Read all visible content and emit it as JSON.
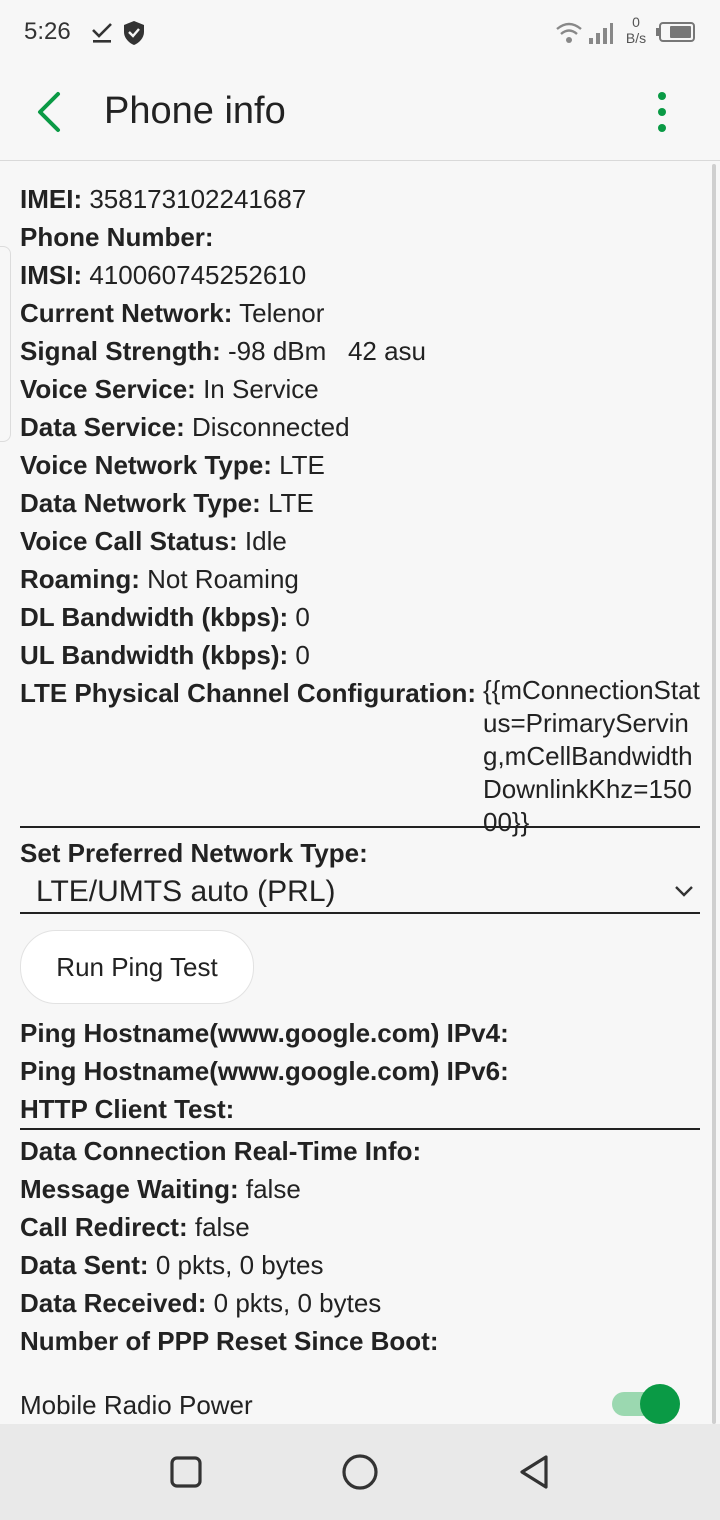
{
  "status_bar": {
    "time": "5:26",
    "icons": [
      "download-done-icon",
      "shield-icon",
      "wifi-icon",
      "signal-icon",
      "battery-icon"
    ],
    "net_speed_value": "0",
    "net_speed_unit": "B/s"
  },
  "app_bar": {
    "title": "Phone info",
    "back_icon": "back-arrow-icon",
    "menu_icon": "more-vert-icon",
    "accent_color": "#0a9a45"
  },
  "info_rows_1": [
    {
      "label": "IMEI:",
      "value": "358173102241687"
    },
    {
      "label": "Phone Number:",
      "value": ""
    },
    {
      "label": "IMSI:",
      "value": "410060745252610"
    },
    {
      "label": "Current Network:",
      "value": "Telenor"
    },
    {
      "label": "Signal Strength:",
      "value": "-98 dBm   42 asu"
    },
    {
      "label": "Voice Service:",
      "value": "In Service"
    },
    {
      "label": "Data Service:",
      "value": "Disconnected"
    },
    {
      "label": "Voice Network Type:",
      "value": "LTE"
    },
    {
      "label": "Data Network Type:",
      "value": "LTE"
    },
    {
      "label": "Voice Call Status:",
      "value": "Idle"
    },
    {
      "label": "Roaming:",
      "value": "Not Roaming"
    },
    {
      "label": "DL Bandwidth (kbps):",
      "value": "0"
    },
    {
      "label": "UL Bandwidth (kbps):",
      "value": "0"
    }
  ],
  "lte_config": {
    "label": "LTE Physical Channel Configuration:",
    "value": "{{mConnectionStatus=PrimaryServing,mCellBandwidthDownlinkKhz=15000}}"
  },
  "preferred_network": {
    "label": "Set Preferred Network Type:",
    "selected": "LTE/UMTS auto (PRL)"
  },
  "ping": {
    "button": "Run Ping Test",
    "rows": [
      {
        "label": "Ping Hostname(www.google.com) IPv4:"
      },
      {
        "label": "Ping Hostname(www.google.com) IPv6:"
      },
      {
        "label": "HTTP Client Test:"
      }
    ]
  },
  "info_rows_2": [
    {
      "label": "Data Connection Real-Time Info:",
      "value": ""
    },
    {
      "label": "Message Waiting:",
      "value": "false"
    },
    {
      "label": "Call Redirect:",
      "value": "false"
    },
    {
      "label": "Data Sent:",
      "value": "0 pkts, 0 bytes"
    },
    {
      "label": "Data Received:",
      "value": "0 pkts, 0 bytes"
    },
    {
      "label": "Number of PPP Reset Since Boot:",
      "value": ""
    }
  ],
  "mobile_radio": {
    "label": "Mobile Radio Power",
    "enabled": true
  },
  "nav_bar": {
    "buttons": [
      "recents-square-icon",
      "home-circle-icon",
      "back-triangle-icon"
    ]
  }
}
